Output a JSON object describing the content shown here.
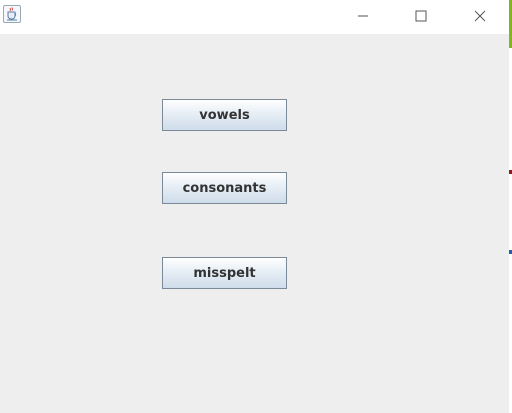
{
  "window": {
    "title": "",
    "icon": "java-coffee-cup-icon",
    "controls": {
      "minimize_icon": "minimize-icon",
      "maximize_icon": "maximize-icon",
      "close_icon": "close-icon"
    }
  },
  "buttons": [
    {
      "label": "vowels"
    },
    {
      "label": "consonants"
    },
    {
      "label": "misspelt"
    }
  ],
  "colors": {
    "background": "#eeeeee",
    "button_border": "#7a8a99",
    "button_text": "#333333"
  }
}
